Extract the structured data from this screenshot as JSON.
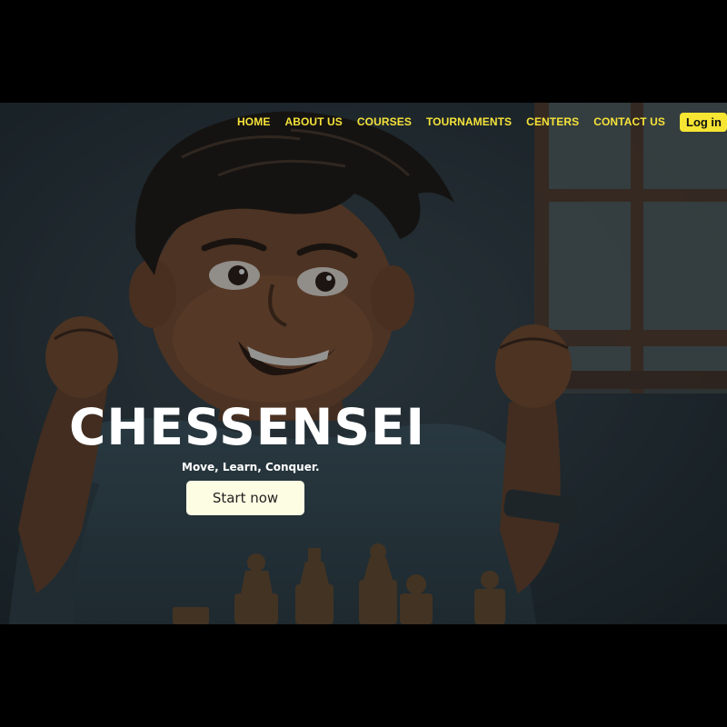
{
  "nav": {
    "items": [
      {
        "label": "HOME"
      },
      {
        "label": "ABOUT US"
      },
      {
        "label": "COURSES"
      },
      {
        "label": "TOURNAMENTS"
      },
      {
        "label": "CENTERS"
      },
      {
        "label": "CONTACT US"
      }
    ],
    "login_label": "Log in"
  },
  "hero": {
    "title": "CHESSENSEI",
    "tagline": "Move, Learn, Conquer.",
    "cta_label": "Start now"
  },
  "colors": {
    "accent": "#f6e33a",
    "button_bg": "#fdfde3",
    "overlay": "#27323a"
  }
}
